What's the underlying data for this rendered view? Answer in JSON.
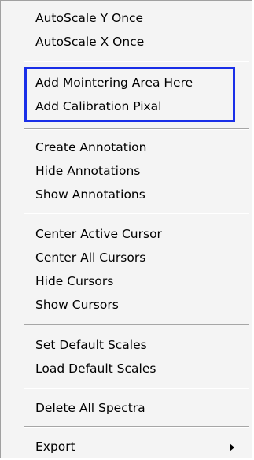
{
  "menu": {
    "items": [
      {
        "label": "AutoScale Y Once"
      },
      {
        "label": "AutoScale X Once"
      },
      {
        "label": "Add Mointering Area Here"
      },
      {
        "label": "Add Calibration Pixal"
      },
      {
        "label": "Create Annotation"
      },
      {
        "label": "Hide Annotations"
      },
      {
        "label": "Show Annotations"
      },
      {
        "label": "Center Active Cursor"
      },
      {
        "label": "Center All Cursors"
      },
      {
        "label": "Hide Cursors"
      },
      {
        "label": "Show Cursors"
      },
      {
        "label": "Set Default Scales"
      },
      {
        "label": "Load Default Scales"
      },
      {
        "label": "Delete All Spectra"
      },
      {
        "label": "Export",
        "icon": "submenu-arrow-icon"
      }
    ],
    "highlight_color": "#1a2fe8"
  }
}
